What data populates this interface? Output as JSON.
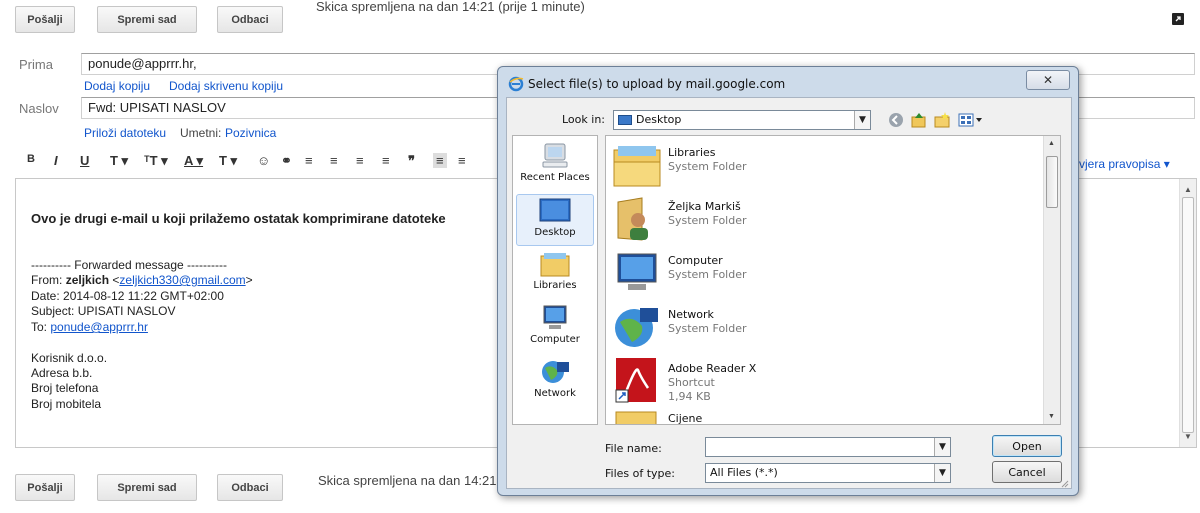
{
  "top_toolbar": {
    "send": "Pošalji",
    "save_now": "Spremi sad",
    "discard": "Odbaci",
    "draft_status": "Skica spremljena na dan 14:21 (prije 1 minute)"
  },
  "compose": {
    "to_label": "Prima",
    "to_value": "ponude@apprrr.hr,",
    "add_cc": "Dodaj kopiju",
    "add_bcc": "Dodaj skrivenu kopiju",
    "subject_label": "Naslov",
    "subject_value": "Fwd: UPISATI NASLOV",
    "attach_file": "Priloži datoteku",
    "insert_label": "Umetni:",
    "invitation": "Pozivnica",
    "spellcheck": "vjera pravopisa ▾"
  },
  "format_toolbar": [
    "B",
    "I",
    "U",
    "T ▾",
    "ᵀT ▾",
    "A ▾",
    "T ▾",
    "☺",
    "⚭",
    "≡",
    "≡",
    "≡",
    "≡",
    "❞",
    "≡",
    "≡"
  ],
  "body": {
    "intro": "Ovo je drugi e-mail u koji prilažemo ostatak komprimirane datoteke",
    "fwd_header": "---------- Forwarded message ----------",
    "from_label": "From:",
    "from_name": "zeljkich",
    "from_email": "zeljkich330@gmail.com",
    "date_line": "Date: 2014-08-12 11:22 GMT+02:00",
    "subject_line": "Subject: UPISATI NASLOV",
    "to_label": "To:",
    "to_email": "ponude@apprrr.hr",
    "sig1": "Korisnik d.o.o.",
    "sig2": "Adresa b.b.",
    "sig3": "Broj telefona",
    "sig4": "Broj mobitela"
  },
  "bottom_toolbar": {
    "send": "Pošalji",
    "save_now": "Spremi sad",
    "discard": "Odbaci",
    "draft_status": "Skica spremljena na dan 14:21"
  },
  "dialog": {
    "title": "Select file(s) to upload by mail.google.com",
    "close": "✕",
    "look_in_label": "Look in:",
    "look_in_value": "Desktop",
    "places": [
      "Recent Places",
      "Desktop",
      "Libraries",
      "Computer",
      "Network"
    ],
    "items": [
      {
        "name": "Libraries",
        "type": "System Folder",
        "size": ""
      },
      {
        "name": "Željka Markiš",
        "type": "System Folder",
        "size": ""
      },
      {
        "name": "Computer",
        "type": "System Folder",
        "size": ""
      },
      {
        "name": "Network",
        "type": "System Folder",
        "size": ""
      },
      {
        "name": "Adobe Reader X",
        "type": "Shortcut",
        "size": "1,94 KB"
      },
      {
        "name": "Cijene",
        "type": "",
        "size": ""
      }
    ],
    "file_name_label": "File name:",
    "file_name_value": "",
    "files_of_type_label": "Files of type:",
    "files_of_type_value": "All Files (*.*)",
    "open": "Open",
    "cancel": "Cancel"
  }
}
